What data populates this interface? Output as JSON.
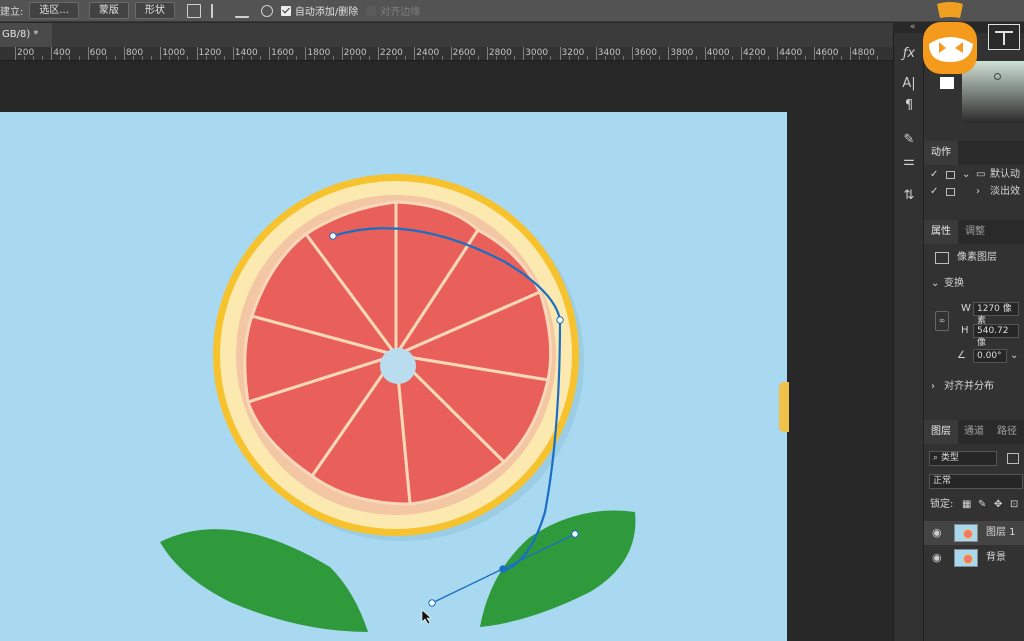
{
  "options_bar": {
    "label": "建立:",
    "buttons": [
      "选区...",
      "蒙版",
      "形状"
    ],
    "auto_add_delete": "自动添加/删除",
    "align_edges": "对齐边缘"
  },
  "document_tab": {
    "title": "GB/8) *",
    "close": "×"
  },
  "panel_collapse": "«",
  "ruler": {
    "labels": [
      "200",
      "400",
      "600",
      "800",
      "1000",
      "1200",
      "1400",
      "1600",
      "1800",
      "2000",
      "2200",
      "2400",
      "2600",
      "2800",
      "3000",
      "3200",
      "3400",
      "3600",
      "3800",
      "4000",
      "4200",
      "4400",
      "4600",
      "4800"
    ]
  },
  "actions_panel": {
    "tab": "动作",
    "items": [
      "默认动",
      "淡出效"
    ]
  },
  "properties_panel": {
    "tabs": [
      "属性",
      "调整"
    ],
    "layer_type": "像素图层",
    "section_transform": "变换",
    "w_label": "W",
    "w_value": "1270 像素",
    "h_label": "H",
    "h_value": "540.72 像",
    "angle_value": "0.00°",
    "section_align": "对齐并分布"
  },
  "layers_panel": {
    "tabs": [
      "图层",
      "通道",
      "路径"
    ],
    "filter_kind": "类型",
    "blend_mode": "正常",
    "lock_label": "锁定:",
    "layers": [
      "图层 1",
      "背景"
    ]
  },
  "colors": {
    "photo_bg": "#a8d8f0",
    "path_stroke": "#1a6fc4",
    "ui_dark": "#323232"
  }
}
